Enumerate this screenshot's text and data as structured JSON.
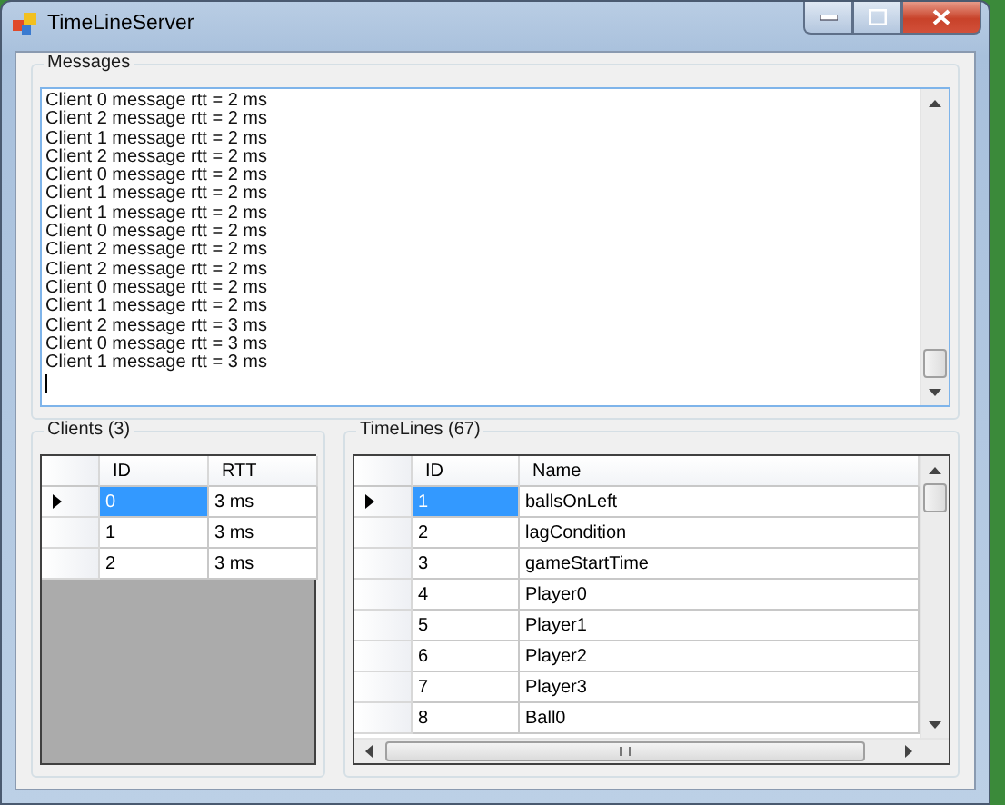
{
  "window": {
    "title": "TimeLineServer"
  },
  "messages": {
    "label": "Messages",
    "lines": [
      "Client 0 message rtt = 2 ms",
      "Client 2 message rtt = 2 ms",
      "Client 1 message rtt = 2 ms",
      "Client 2 message rtt = 2 ms",
      "Client 0 message rtt = 2 ms",
      "Client 1 message rtt = 2 ms",
      "Client 1 message rtt = 2 ms",
      "Client 0 message rtt = 2 ms",
      "Client 2 message rtt = 2 ms",
      "Client 2 message rtt = 2 ms",
      "Client 0 message rtt = 2 ms",
      "Client 1 message rtt = 2 ms",
      "Client 2 message rtt = 3 ms",
      "Client 0 message rtt = 3 ms",
      "Client 1 message rtt = 3 ms"
    ]
  },
  "clients": {
    "label": "Clients (3)",
    "columns": [
      "ID",
      "RTT"
    ],
    "rows": [
      {
        "selected": true,
        "cells": [
          "0",
          "3 ms"
        ]
      },
      {
        "selected": false,
        "cells": [
          "1",
          "3 ms"
        ]
      },
      {
        "selected": false,
        "cells": [
          "2",
          "3 ms"
        ]
      }
    ]
  },
  "timelines": {
    "label": "TimeLines (67)",
    "columns": [
      "ID",
      "Name"
    ],
    "rows": [
      {
        "selected": true,
        "cells": [
          "1",
          "ballsOnLeft"
        ]
      },
      {
        "selected": false,
        "cells": [
          "2",
          "lagCondition"
        ]
      },
      {
        "selected": false,
        "cells": [
          "3",
          "gameStartTime"
        ]
      },
      {
        "selected": false,
        "cells": [
          "4",
          "Player0"
        ]
      },
      {
        "selected": false,
        "cells": [
          "5",
          "Player1"
        ]
      },
      {
        "selected": false,
        "cells": [
          "6",
          "Player2"
        ]
      },
      {
        "selected": false,
        "cells": [
          "7",
          "Player3"
        ]
      },
      {
        "selected": false,
        "cells": [
          "8",
          "Ball0"
        ]
      }
    ]
  }
}
